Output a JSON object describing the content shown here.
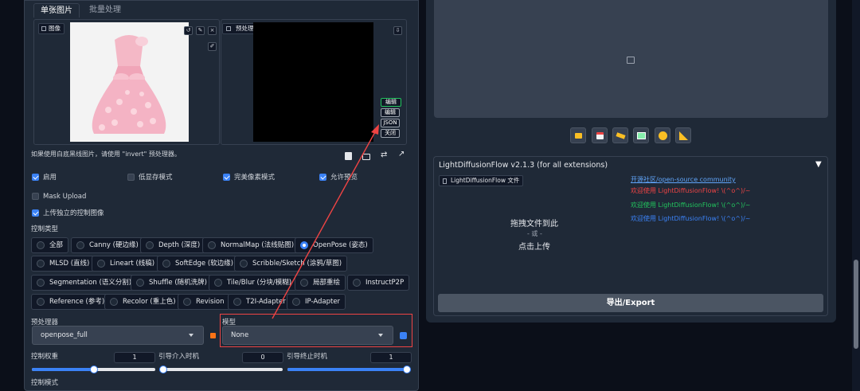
{
  "tabs": {
    "single": "单张图片",
    "batch": "批量处理"
  },
  "image_panel": {
    "label": "图像",
    "preview_label": "预处理结果预览"
  },
  "side_buttons": [
    "编辑",
    "编辑",
    "JSON",
    "关闭"
  ],
  "hint": "如果使用白底黑线图片，请使用 \"invert\" 预处理器。",
  "checks": {
    "enable": "启用",
    "low_vram": "低显存模式",
    "pixel_perfect": "完美像素模式",
    "allow_preview": "允许预览",
    "mask_upload": "Mask Upload",
    "upload_independent": "上传独立的控制图像"
  },
  "control_type": {
    "label": "控制类型",
    "row1": [
      "全部",
      "Canny (硬边缘)",
      "Depth (深度)",
      "NormalMap (法线贴图)",
      "OpenPose (姿态)"
    ],
    "row2": [
      "MLSD (直线)",
      "Lineart (线稿)",
      "SoftEdge (软边缘)",
      "Scribble/Sketch (涂鸦/草图)"
    ],
    "row3": [
      "Segmentation (语义分割)",
      "Shuffle (随机洗牌)",
      "Tile/Blur (分块/模糊)",
      "局部重绘",
      "InstructP2P"
    ],
    "row4": [
      "Reference (参考)",
      "Recolor (重上色)",
      "Revision",
      "T2I-Adapter",
      "IP-Adapter"
    ],
    "selected": "OpenPose (姿态)"
  },
  "preprocessor": {
    "label": "预处理器",
    "value": "openpose_full"
  },
  "model": {
    "label": "模型",
    "value": "None"
  },
  "weights": {
    "weight_label": "控制权重",
    "weight_value": "1",
    "start_label": "引导介入时机",
    "start_value": "0",
    "end_label": "引导终止时机",
    "end_value": "1"
  },
  "control_mode_label": "控制模式",
  "ldf": {
    "title": "LightDiffusionFlow v2.1.3 (for all extensions)",
    "file_label": "LightDiffusionFlow 文件",
    "drop_line1": "拖拽文件到此",
    "drop_or": "- 或 -",
    "drop_line2": "点击上传",
    "link_community": "开源社区/open-source community",
    "welcome_red": "欢迎使用 LightDiffusionFlow! \\(^o^)/~",
    "welcome_green": "欢迎使用 LightDiffusionFlow! \\(^o^)/~",
    "welcome_blue": "欢迎使用 LightDiffusionFlow! \\(^o^)/~",
    "export": "导出/Export",
    "colors": {
      "red": "#ef4444",
      "green": "#22c55e",
      "blue": "#3b82f6",
      "link": "#60a5fa"
    }
  },
  "toolbar_icons": [
    "folder-icon",
    "save-icon",
    "send-icon",
    "image-icon",
    "palette-icon",
    "ruler-icon"
  ]
}
